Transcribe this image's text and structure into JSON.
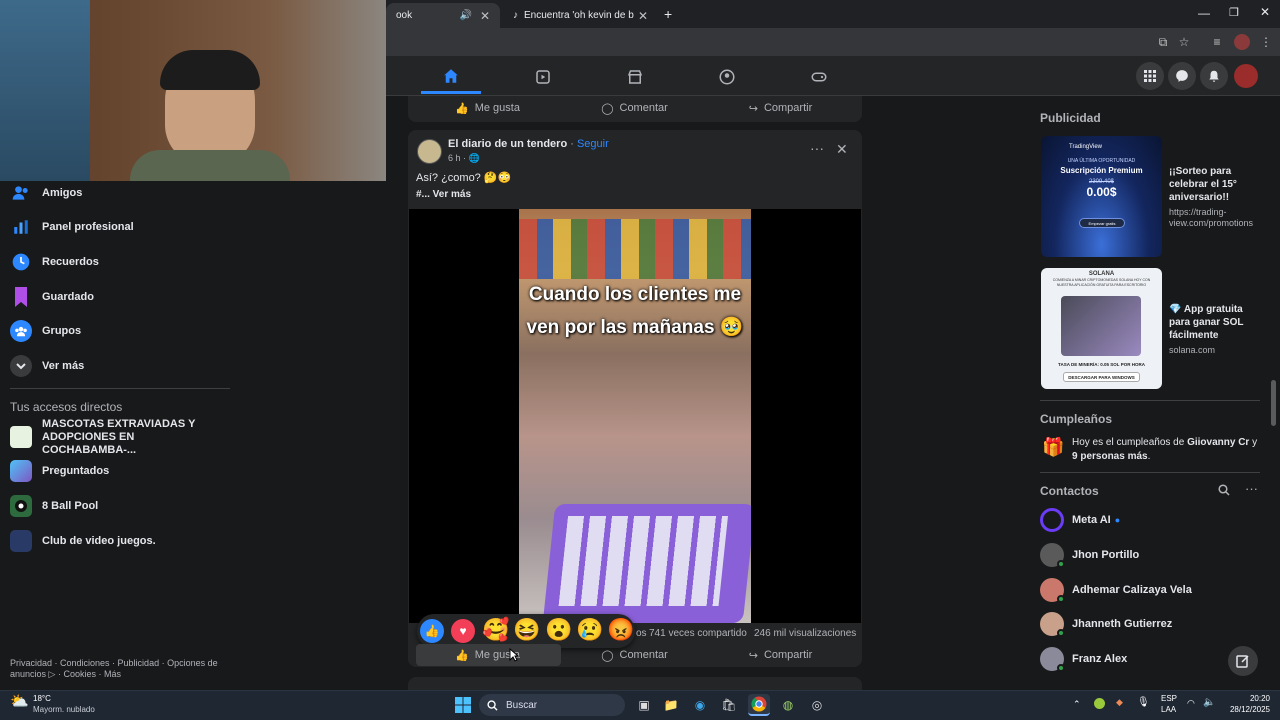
{
  "browser": {
    "tabs": [
      {
        "label": "ook",
        "active": true
      },
      {
        "label": "Encuentra 'oh kevin de bruyne'",
        "active": false
      }
    ],
    "new_tab": "+"
  },
  "left_nav": {
    "items": [
      {
        "label": "Amigos",
        "icon": "friends-icon"
      },
      {
        "label": "Panel profesional",
        "icon": "dashboard-icon"
      },
      {
        "label": "Recuerdos",
        "icon": "memories-icon"
      },
      {
        "label": "Guardado",
        "icon": "saved-icon"
      },
      {
        "label": "Grupos",
        "icon": "groups-icon"
      },
      {
        "label": "Ver más",
        "icon": "chevron-down-icon"
      }
    ],
    "shortcuts_title": "Tus accesos directos",
    "shortcuts": [
      {
        "label": "MASCOTAS EXTRAVIADAS Y ADOPCIONES EN COCHABAMBA-..."
      },
      {
        "label": "Preguntados"
      },
      {
        "label": "8 Ball Pool"
      },
      {
        "label": "Club de video juegos."
      }
    ],
    "footer": "Privacidad · Condiciones · Publicidad · Opciones de anuncios ▷ · Cookies · Más"
  },
  "feed": {
    "prev_post_actions": {
      "like": "Me gusta",
      "comment": "Comentar",
      "share": "Compartir"
    },
    "post": {
      "author": "El diario de un tendero",
      "follow": "Seguir",
      "time": "6 h ·",
      "text": "Así? ¿como? 🤔😳",
      "see_more": "#... Ver más",
      "video_caption": "Cuando los clientes me ven por las mañanas 🥹",
      "shares": "741 veces compartido",
      "views": "246 mil visualizaciones",
      "reactions_tail": "os",
      "actions": {
        "like": "Me gusta",
        "comment": "Comentar",
        "share": "Compartir"
      }
    }
  },
  "right_col": {
    "ads_title": "Publicidad",
    "ads": [
      {
        "headline": "¡¡Sorteo para celebrar el 15° aniversario!!",
        "url": "https://trading-view.com/promotions",
        "image_brand": "TradingView",
        "image_line1": "UNA ÚLTIMA OPORTUNIDAD",
        "image_line2": "Suscripción Premium",
        "image_old_price": "2309.40$",
        "image_price": "0.00$",
        "image_button": "Empezar gratis"
      },
      {
        "headline": "💎 App gratuita para ganar SOL fácilmente",
        "url": "solana.com",
        "image_brand": "SOLANA",
        "image_line1": "COMIENZA A MINAR CRIPTOMONEDAS SOLANA HOY CON NUESTRA APLICACIÓN GRATUITA PARA ESCRITORIO",
        "image_rate": "TASA DE MINERÍA: 0.05 SOL POR HORA",
        "image_button": "DESCARGAR PARA WINDOWS"
      }
    ],
    "birthdays_title": "Cumpleaños",
    "birthday_text_pre": "Hoy es el cumpleaños de ",
    "birthday_name": "Giiovanny Cr",
    "birthday_text_mid": " y ",
    "birthday_others": "9 personas más",
    "birthday_end": ".",
    "contacts_title": "Contactos",
    "contacts": [
      {
        "name": "Meta AI",
        "color": "#6b3cf5"
      },
      {
        "name": "Jhon Portillo",
        "color": "#5a5a5a"
      },
      {
        "name": "Adhemar Calizaya Vela",
        "color": "#c9786b"
      },
      {
        "name": "Jhanneth Gutierrez",
        "color": "#c9a08a"
      },
      {
        "name": "Franz Alex",
        "color": "#8a8a9a"
      }
    ]
  },
  "taskbar": {
    "weather_temp": "18°C",
    "weather_desc": "Mayorm. nublado",
    "search_placeholder": "Buscar",
    "lang": "ESP",
    "lang_sub": "LAA",
    "time": "20:20",
    "date": "28/12/2025"
  },
  "colors": {
    "accent": "#2d88ff",
    "bg": "#18191a",
    "card": "#242526"
  }
}
